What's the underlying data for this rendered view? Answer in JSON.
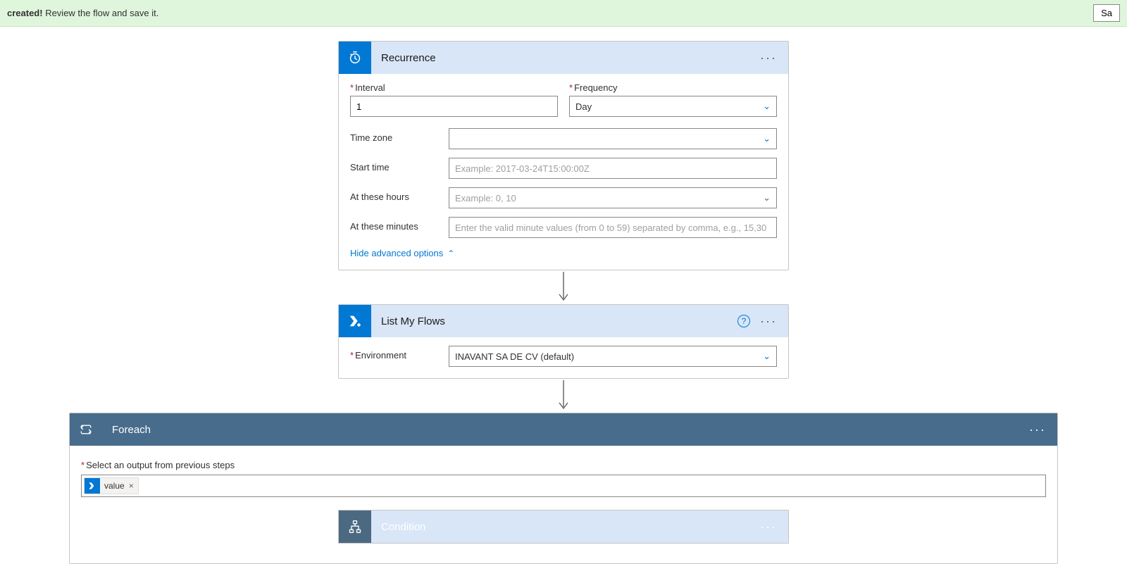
{
  "banner": {
    "bold": "created!",
    "rest": " Review the flow and save it.",
    "button": "Sa"
  },
  "recurrence": {
    "title": "Recurrence",
    "interval_label": "Interval",
    "interval_value": "1",
    "frequency_label": "Frequency",
    "frequency_value": "Day",
    "timezone_label": "Time zone",
    "timezone_value": "",
    "starttime_label": "Start time",
    "starttime_placeholder": "Example: 2017-03-24T15:00:00Z",
    "hours_label": "At these hours",
    "hours_placeholder": "Example: 0, 10",
    "minutes_label": "At these minutes",
    "minutes_placeholder": "Enter the valid minute values (from 0 to 59) separated by comma, e.g., 15,30",
    "advanced_link": "Hide advanced options"
  },
  "listflows": {
    "title": "List My Flows",
    "env_label": "Environment",
    "env_value": "INAVANT SA DE CV (default)"
  },
  "foreach": {
    "title": "Foreach",
    "output_label": "Select an output from previous steps",
    "token": "value"
  },
  "condition": {
    "title": "Condition"
  }
}
